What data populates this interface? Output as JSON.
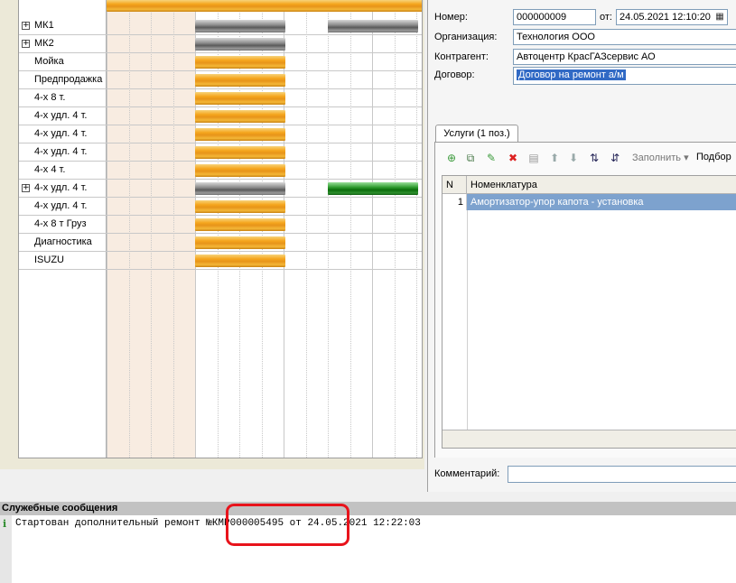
{
  "gantt": {
    "rows": [
      {
        "label": "МК1",
        "expandable": true,
        "bars": [
          {
            "style": "gray"
          },
          {
            "style": "gray"
          }
        ]
      },
      {
        "label": "МК2",
        "expandable": true,
        "bars": [
          {
            "style": "gray"
          }
        ]
      },
      {
        "label": "Мойка",
        "expandable": false,
        "bars": [
          {
            "style": "orange"
          }
        ]
      },
      {
        "label": "Предпродажка",
        "expandable": false,
        "bars": [
          {
            "style": "orange"
          }
        ]
      },
      {
        "label": "4-х 8 т.",
        "expandable": false,
        "bars": [
          {
            "style": "orange"
          }
        ]
      },
      {
        "label": "4-х удл. 4 т.",
        "expandable": false,
        "bars": [
          {
            "style": "orange"
          }
        ]
      },
      {
        "label": "4-х удл. 4 т.",
        "expandable": false,
        "bars": [
          {
            "style": "orange"
          }
        ]
      },
      {
        "label": "4-х удл. 4 т.",
        "expandable": false,
        "bars": [
          {
            "style": "orange"
          }
        ]
      },
      {
        "label": "4-х 4 т.",
        "expandable": false,
        "bars": [
          {
            "style": "orange"
          }
        ]
      },
      {
        "label": "4-х удл. 4 т.",
        "expandable": true,
        "bars": [
          {
            "style": "gray"
          },
          {
            "style": "green"
          }
        ]
      },
      {
        "label": "4-х удл. 4 т.",
        "expandable": false,
        "bars": [
          {
            "style": "orange"
          }
        ]
      },
      {
        "label": "4-х 8 т Груз",
        "expandable": false,
        "bars": [
          {
            "style": "orange"
          }
        ]
      },
      {
        "label": "Диагностика",
        "expandable": false,
        "bars": [
          {
            "style": "orange"
          }
        ]
      },
      {
        "label": "ISUZU",
        "expandable": false,
        "bars": [
          {
            "style": "orange"
          }
        ]
      }
    ],
    "colors": {
      "orange": "#f5a51c",
      "gray": "#6f6f6f",
      "green": "#0c6d0c",
      "shade": "#f8ece1"
    }
  },
  "form": {
    "number_label": "Номер:",
    "number_value": "000000009",
    "date_label": "от:",
    "date_value": "24.05.2021 12:10:20",
    "org_label": "Организация:",
    "org_value": "Технология ООО",
    "contractor_label": "Контрагент:",
    "contractor_value": "Автоцентр КрасГАЗсервис АО",
    "contract_label": "Договор:",
    "contract_value": "Договор на ремонт а/м",
    "tab_label": "Услуги (1 поз.)",
    "toolbar": {
      "icons": [
        "add-icon",
        "copy-icon",
        "edit-icon",
        "delete-icon",
        "save-icon",
        "move-up-icon",
        "move-down-icon",
        "sort-asc-icon",
        "sort-desc-icon"
      ],
      "fill_label": "Заполнить",
      "pick_label": "Подбор"
    },
    "table": {
      "columns": [
        "N",
        "Номенклатура"
      ],
      "rows": [
        {
          "n": "1",
          "item": "Амортизатор-упор капота - установка"
        }
      ]
    },
    "comment_label": "Комментарий:"
  },
  "messages": {
    "title": "Служебные сообщения",
    "items": [
      {
        "text": "Стартован дополнительный ремонт №КМР000005495 от 24.05.2021 12:22:03"
      }
    ],
    "highlight_color": "#e8131b"
  }
}
